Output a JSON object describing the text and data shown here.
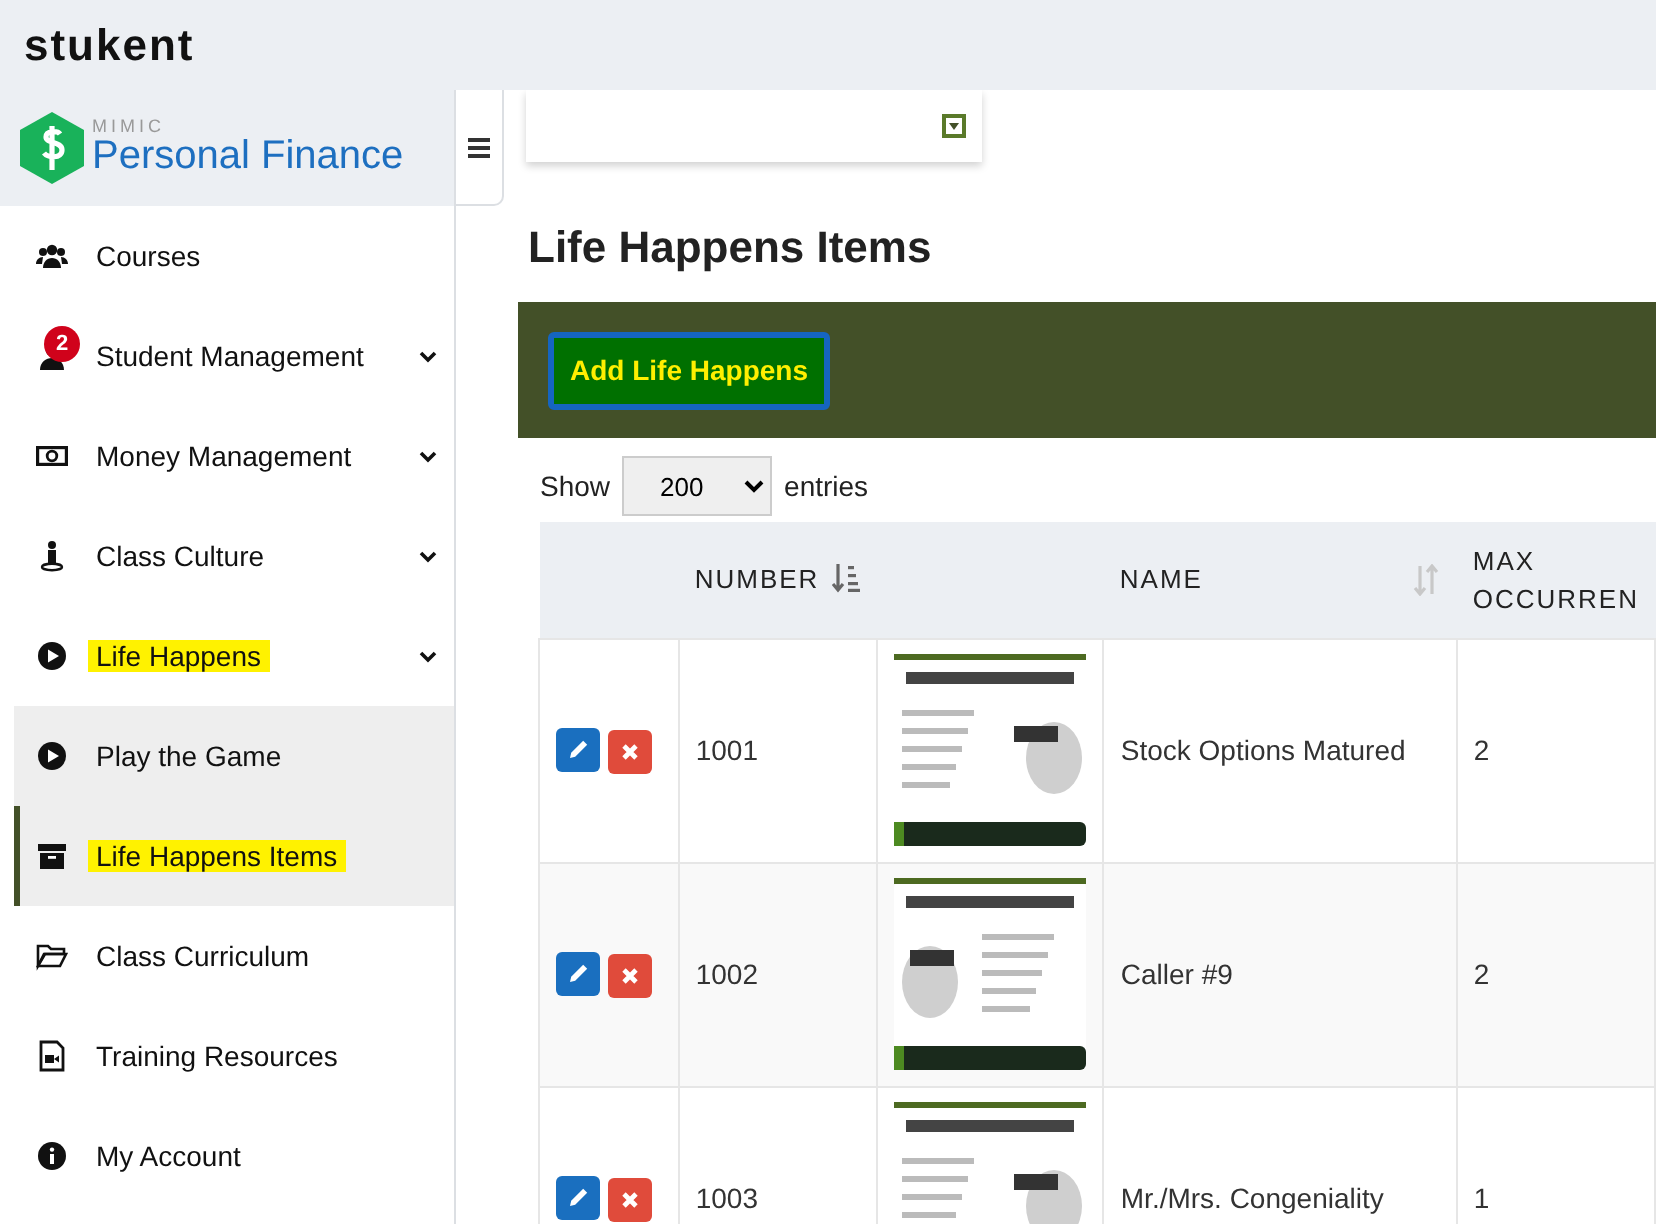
{
  "brand": "stukent",
  "app": {
    "kicker": "MIMIC",
    "title": "Personal Finance"
  },
  "sidebar": {
    "items": [
      {
        "label": "Courses",
        "has_submenu": false,
        "highlighted": false
      },
      {
        "label": "Student Management",
        "badge": "2",
        "has_submenu": true,
        "highlighted": false
      },
      {
        "label": "Money Management",
        "has_submenu": true,
        "highlighted": false
      },
      {
        "label": "Class Culture",
        "has_submenu": true,
        "highlighted": false
      },
      {
        "label": "Life Happens",
        "has_submenu": true,
        "expanded": true,
        "highlighted": true,
        "children": [
          {
            "label": "Play the Game",
            "selected": false,
            "highlighted": false
          },
          {
            "label": "Life Happens Items",
            "selected": true,
            "highlighted": true
          }
        ]
      },
      {
        "label": "Class Curriculum",
        "has_submenu": false,
        "highlighted": false
      },
      {
        "label": "Training Resources",
        "has_submenu": false,
        "highlighted": false
      },
      {
        "label": "My Account",
        "has_submenu": false,
        "highlighted": false
      }
    ]
  },
  "page_title": "Life Happens Items",
  "add_button": "Add Life Happens",
  "length_menu": {
    "label_before": "Show",
    "value": "200",
    "label_after": "entries"
  },
  "table": {
    "columns": [
      {},
      {
        "label": "NUMBER",
        "sort_active": true
      },
      {},
      {
        "label": "NAME",
        "sort_active": false
      },
      {
        "label": "MAX OCCURREN"
      }
    ],
    "rows": [
      {
        "number": "1001",
        "name": "Stock Options Matured",
        "max": "2"
      },
      {
        "number": "1002",
        "name": "Caller #9",
        "max": "2"
      },
      {
        "number": "1003",
        "name": "Mr./Mrs. Congeniality",
        "max": "1"
      }
    ]
  }
}
